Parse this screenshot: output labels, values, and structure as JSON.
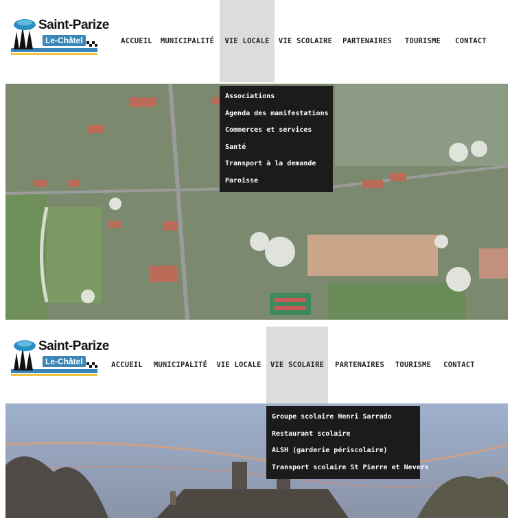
{
  "logo": {
    "title": "Saint-Parize",
    "subtitle": "Le-Châtel"
  },
  "screen1": {
    "nav": [
      {
        "label": "ACCUEIL",
        "active": false
      },
      {
        "label": "MUNICIPALITÉ",
        "active": false
      },
      {
        "label": "VIE LOCALE",
        "active": true
      },
      {
        "label": "VIE SCOLAIRE",
        "active": false
      },
      {
        "label": "PARTENAIRES",
        "active": false
      },
      {
        "label": "TOURISME",
        "active": false
      },
      {
        "label": "CONTACT",
        "active": false
      }
    ],
    "dropdown": [
      "Associations",
      "Agenda des manifestations",
      "Commerces et services",
      "Santé",
      "Transport à la demande",
      "Paroisse"
    ]
  },
  "screen2": {
    "nav": [
      {
        "label": "ACCUEIL",
        "active": false
      },
      {
        "label": "MUNICIPALITÉ",
        "active": false
      },
      {
        "label": "VIE LOCALE",
        "active": false
      },
      {
        "label": "VIE SCOLAIRE",
        "active": true
      },
      {
        "label": "PARTENAIRES",
        "active": false
      },
      {
        "label": "TOURISME",
        "active": false
      },
      {
        "label": "CONTACT",
        "active": false
      }
    ],
    "dropdown": [
      "Groupe scolaire Henri Sarrado",
      "Restaurant scolaire",
      "ALSH (garderie périscolaire)",
      "Transport scolaire St Pierre et Nevers"
    ]
  },
  "colors": {
    "accent": "#dcdcdc",
    "dropdown_bg": "#1b1b1b",
    "logo_blue": "#3a86b8"
  }
}
